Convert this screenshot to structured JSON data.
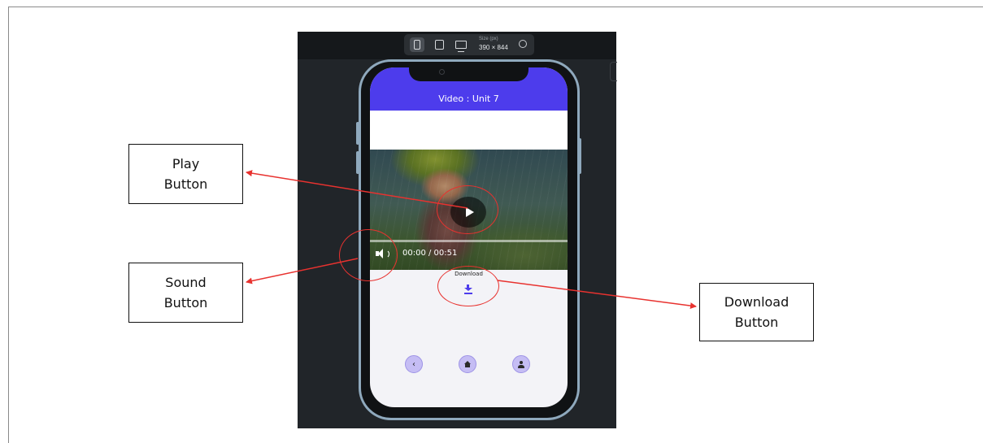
{
  "devtools": {
    "size_label": "Size (px)",
    "size_value": "390 × 844",
    "icons": [
      "phone-icon",
      "tablet-icon",
      "desktop-icon",
      "rotate-icon"
    ]
  },
  "app": {
    "title": "Video : Unit 7",
    "video": {
      "time": "00:00 / 00:51",
      "play_icon": "play-icon",
      "sound_icon": "volume-icon"
    },
    "download_label": "Download",
    "nav": {
      "back_symbol": "‹",
      "icons": [
        "chevron-left-icon",
        "home-icon",
        "person-icon"
      ]
    }
  },
  "annotations": {
    "play": [
      "Play",
      "Button"
    ],
    "sound": [
      "Sound",
      "Button"
    ],
    "download": [
      "Download",
      "Button"
    ],
    "highlight_color": "#e8322f"
  },
  "colors": {
    "header": "#4d3cec",
    "nav_button": "#c5bdf4",
    "phone_frame": "#8fa9bd",
    "editor_bg": "#212529"
  }
}
